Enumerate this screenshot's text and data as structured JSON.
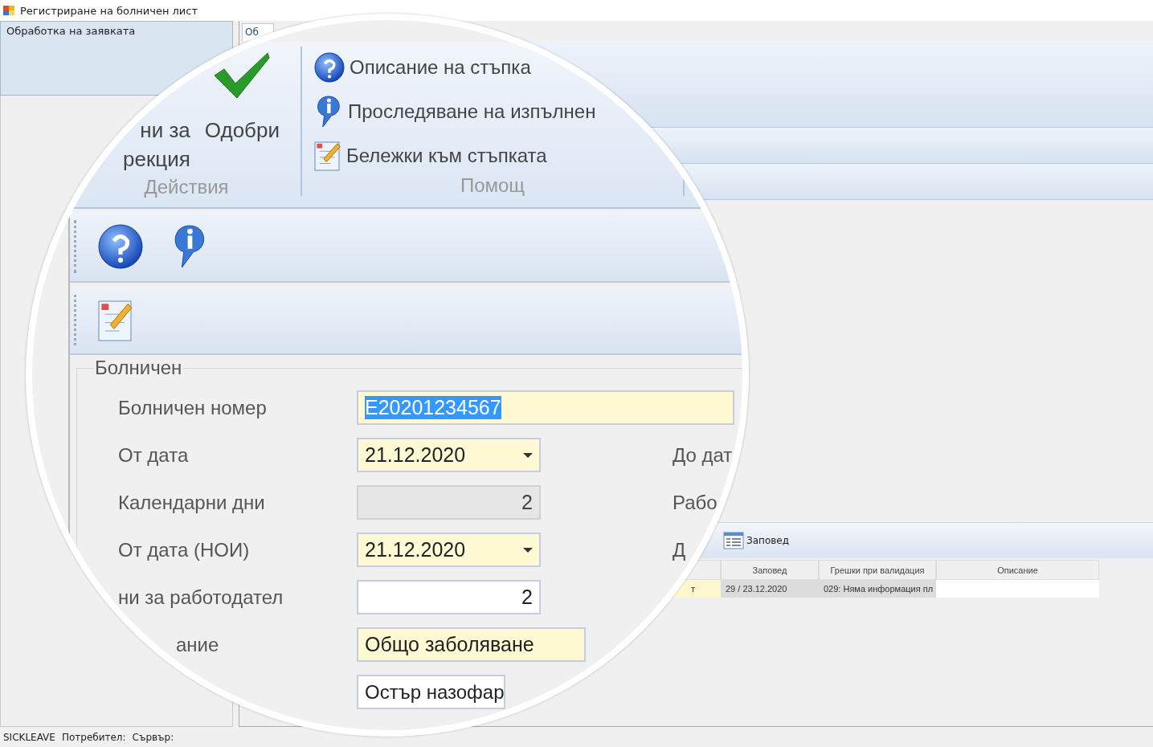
{
  "window": {
    "title": "Регистриране на болничен лист"
  },
  "sidebar": {
    "items": [
      {
        "label": "Обработка на заявката",
        "selected": true
      }
    ]
  },
  "tabs": [
    {
      "label": "Об",
      "selected": true
    }
  ],
  "magnifier": {
    "ribbon": {
      "groups": [
        {
          "label": "Действия",
          "kind": "large",
          "buttons": [
            {
              "kind": "cut",
              "lines": [
                "ни за",
                "рекция"
              ]
            },
            {
              "kind": "approve",
              "lines": [
                "Одобри"
              ]
            }
          ]
        },
        {
          "label": "Помощ",
          "kind": "small",
          "buttons": [
            {
              "kind": "question",
              "lines": [
                "Описание на стъпка"
              ]
            },
            {
              "kind": "info",
              "lines": [
                "Проследяване на изпълнен"
              ]
            },
            {
              "kind": "notes",
              "lines": [
                "Бележки към стъпката"
              ]
            }
          ]
        }
      ]
    },
    "form": {
      "title": "Болничен",
      "fields": [
        {
          "label": "Болничен номер",
          "value": "E20201234567",
          "kind": "text",
          "required": true,
          "disabled": false,
          "selected": true
        },
        {
          "label": "От дата",
          "value": "21.12.2020",
          "kind": "dropdown",
          "required": true,
          "disabled": false,
          "selected": false,
          "side_label": "До дат"
        },
        {
          "label": "Календарни дни",
          "value": "2",
          "kind": "number",
          "required": false,
          "disabled": true,
          "selected": false,
          "side_label": "Рабо"
        },
        {
          "label": "От дата (НОИ)",
          "value": "21.12.2020",
          "kind": "dropdown",
          "required": true,
          "disabled": false,
          "selected": false,
          "side_label": "Д"
        },
        {
          "label": "ни за работодател",
          "value": "2",
          "kind": "number",
          "required": false,
          "disabled": false,
          "selected": false
        },
        {
          "label": "ание",
          "label_clipped": true,
          "value": "Общо заболяване",
          "kind": "text",
          "required": true,
          "disabled": false,
          "selected": false
        },
        {
          "value": "Остър назофар",
          "kind": "text",
          "required": false,
          "disabled": false,
          "selected": false
        }
      ]
    }
  },
  "orders": {
    "toolbar": {
      "label": "Заповед"
    },
    "columns": [
      {
        "label": "Заповед"
      },
      {
        "label": "Грешки при валидация"
      },
      {
        "label": "Описание"
      }
    ],
    "rows": [
      {
        "column_1": "т",
        "order": "29 / 23.12.2020",
        "validation_errors": "029: Няма информация пл"
      }
    ]
  },
  "status_bar": {
    "items": [
      "SICKLEAVE",
      "Потребител:",
      "Сървър:"
    ]
  }
}
